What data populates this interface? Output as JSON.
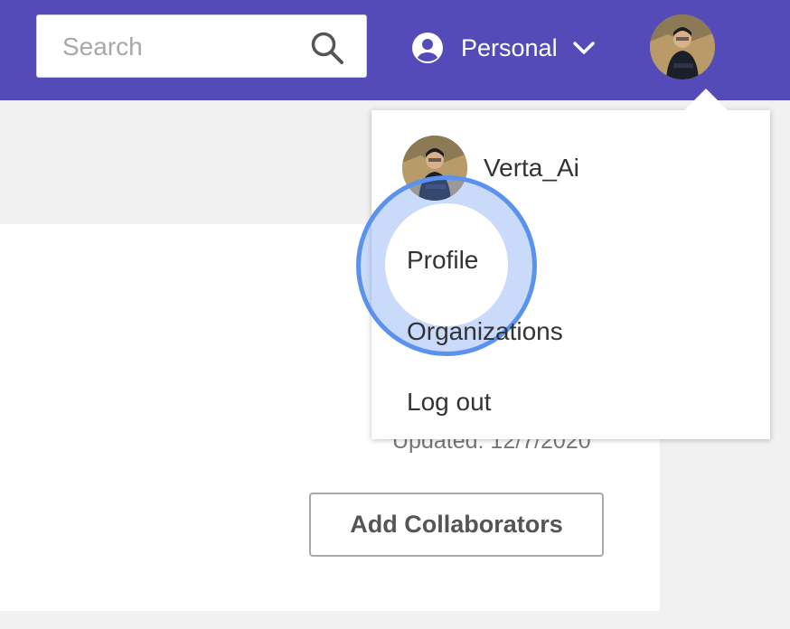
{
  "header": {
    "search_placeholder": "Search",
    "workspace_label": "Personal",
    "icons": {
      "search": "search-icon",
      "user": "user-circle-icon",
      "chevron": "chevron-down-icon"
    },
    "colors": {
      "bar": "#544bb8",
      "highlight": "#5a92ee"
    }
  },
  "dropdown": {
    "username": "Verta_Ai",
    "items": [
      "Profile",
      "Organizations",
      "Log out"
    ]
  },
  "content": {
    "updated_text": "Updated: 12/7/2020",
    "add_button": "Add Collaborators"
  }
}
